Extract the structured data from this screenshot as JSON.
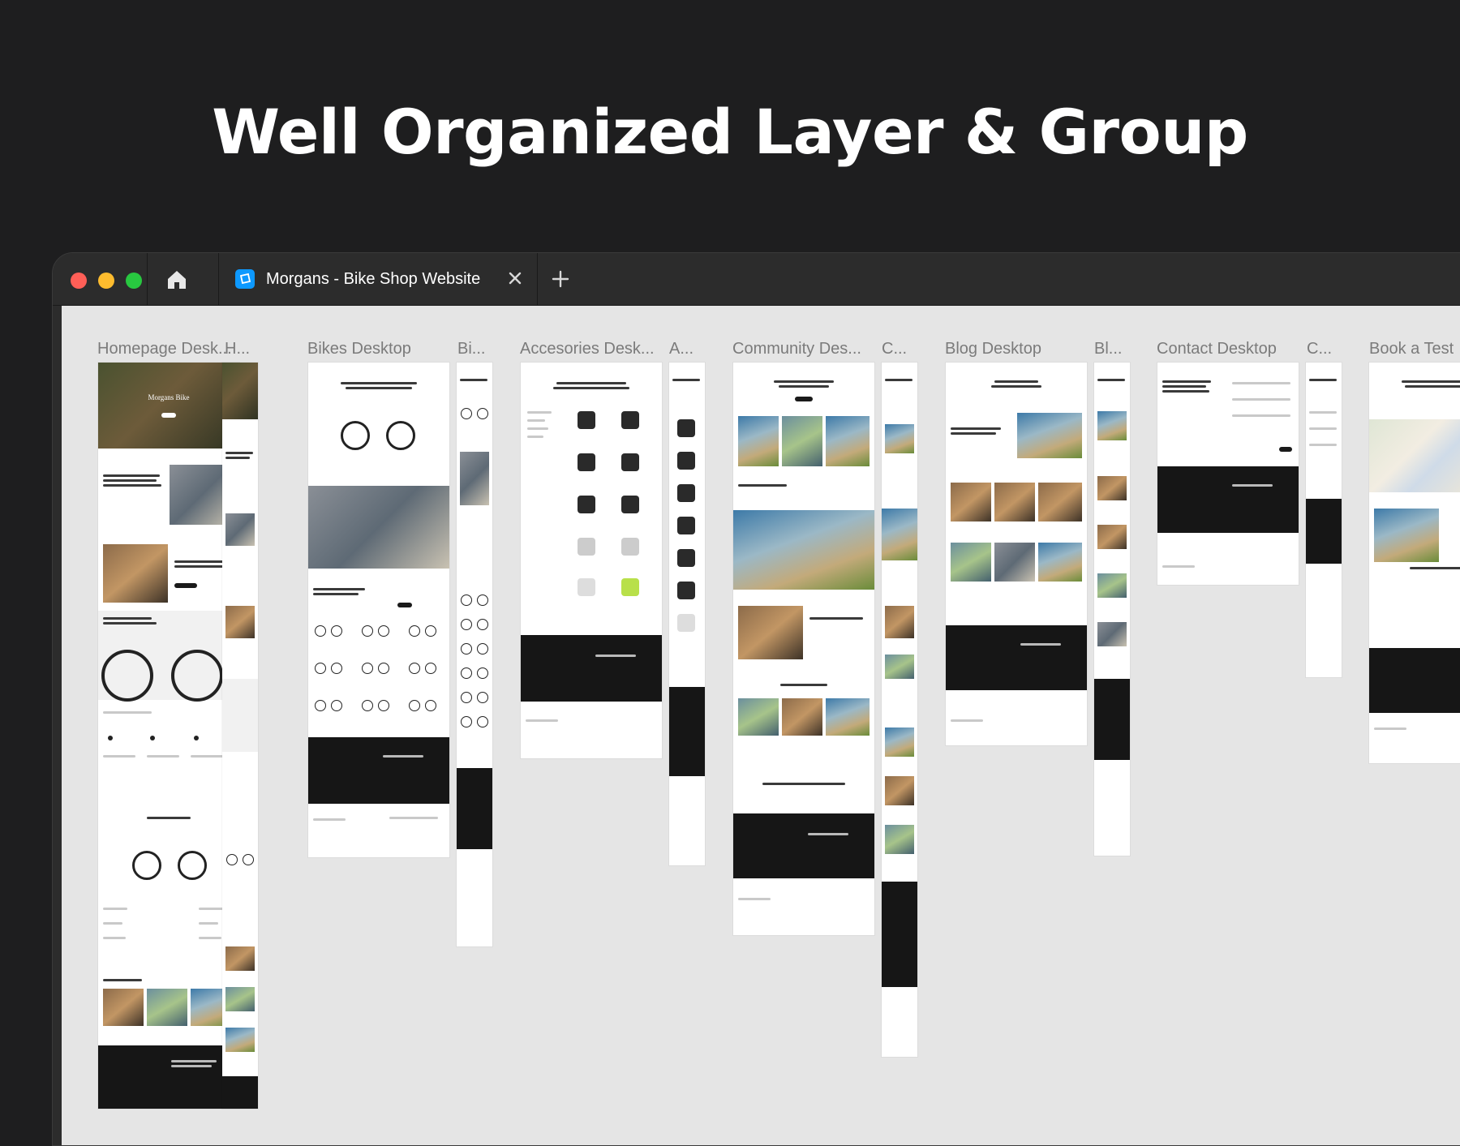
{
  "headline": "Well Organized Layer & Group",
  "window": {
    "tab": {
      "title": "Morgans - Bike Shop Website"
    },
    "icons": {
      "close": "close-window-red",
      "minimize": "minimize-yellow",
      "maximize": "maximize-green",
      "home": "home-icon",
      "tab_close": "close-icon",
      "new_tab": "plus-icon"
    },
    "colors": {
      "titlebar": "#2c2c2c",
      "canvas": "#e5e5e5",
      "page_bg": "#1e1e1f",
      "tab_icon": "#0d99ff"
    }
  },
  "frames": [
    {
      "label": "Homepage Desk..."
    },
    {
      "label": "H..."
    },
    {
      "label": "Bikes Desktop"
    },
    {
      "label": "Bi..."
    },
    {
      "label": "Accesories Desk..."
    },
    {
      "label": "A..."
    },
    {
      "label": "Community Des..."
    },
    {
      "label": "C..."
    },
    {
      "label": "Blog Desktop"
    },
    {
      "label": "Bl..."
    },
    {
      "label": "Contact Desktop"
    },
    {
      "label": "C..."
    },
    {
      "label": "Book a Test"
    }
  ],
  "frame_text": {
    "hero": "Morgans Bike"
  }
}
